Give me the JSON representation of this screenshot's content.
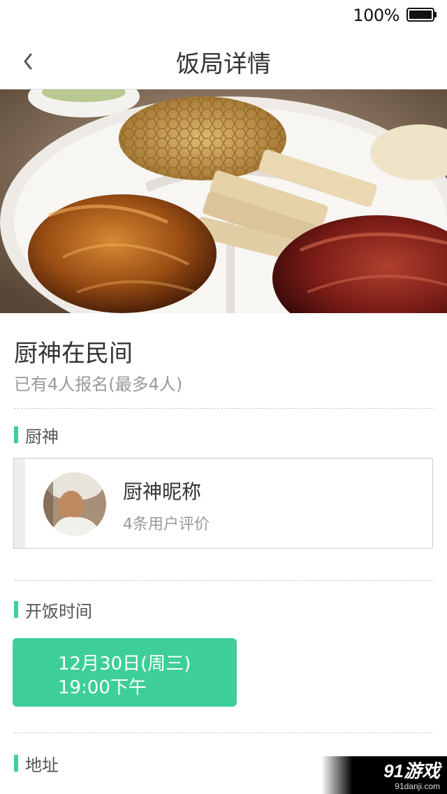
{
  "status_bar": {
    "battery_percent": "100%",
    "battery_icon": "battery-full-icon"
  },
  "nav": {
    "back_icon": "chevron-left-icon",
    "title": "饭局详情"
  },
  "hero": {
    "image": "food-platter-photo"
  },
  "dinner": {
    "name": "厨神在民间",
    "signup_status": "已有4人报名(最多4人)"
  },
  "sections": {
    "chef_label": "厨神",
    "time_label": "开饭时间",
    "address_label": "地址"
  },
  "chef": {
    "nickname": "厨神昵称",
    "reviews": "4条用户评价",
    "avatar_icon": "chef-avatar"
  },
  "time": {
    "date": "12月30日(周三)",
    "hour": "19:00下午"
  },
  "colors": {
    "accent": "#3ecf99",
    "text_primary": "#333333",
    "text_secondary": "#999999"
  },
  "watermark": {
    "brand": "91游戏",
    "url": "91danji.com"
  }
}
